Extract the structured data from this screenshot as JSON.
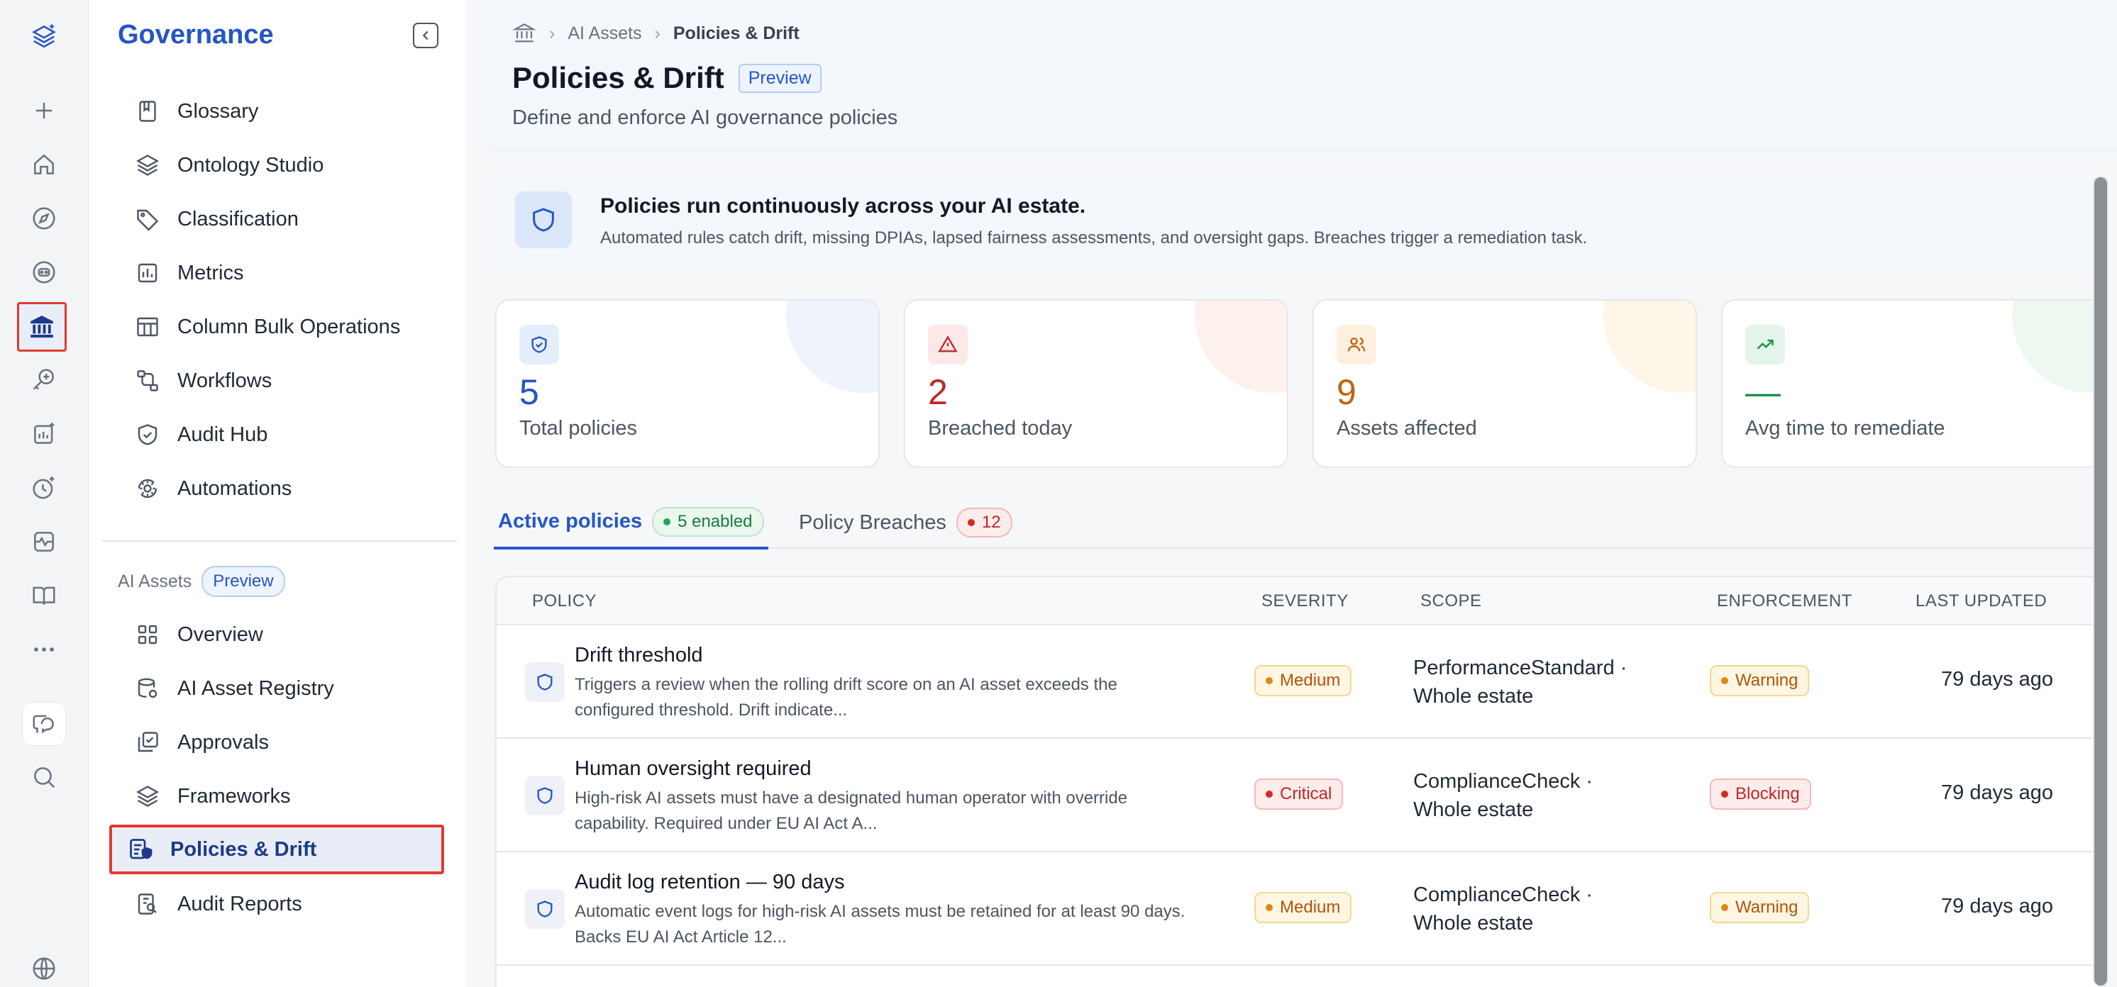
{
  "rail": {
    "items": [
      "layers-sparkle-icon",
      "plus-icon",
      "home-icon",
      "compass-icon",
      "bot-icon",
      "bank-icon",
      "key-search-icon",
      "analytics-sparkle-icon",
      "clock-sparkle-icon",
      "dashboard-icon",
      "book-icon",
      "more-icon",
      "chat-icon",
      "search-icon",
      "globe-icon"
    ]
  },
  "nav": {
    "title": "Governance",
    "items": [
      {
        "label": "Glossary",
        "icon": "bookmark-icon"
      },
      {
        "label": "Ontology Studio",
        "icon": "layers-icon"
      },
      {
        "label": "Classification",
        "icon": "tag-icon"
      },
      {
        "label": "Metrics",
        "icon": "chart-icon"
      },
      {
        "label": "Column Bulk Operations",
        "icon": "columns-icon"
      },
      {
        "label": "Workflows",
        "icon": "workflow-icon"
      },
      {
        "label": "Audit Hub",
        "icon": "shield-check-icon"
      },
      {
        "label": "Automations",
        "icon": "gear-cycle-icon"
      }
    ],
    "section_label": "AI Assets",
    "section_badge": "Preview",
    "ai_items": [
      {
        "label": "Overview",
        "icon": "grid-icon"
      },
      {
        "label": "AI Asset Registry",
        "icon": "database-icon"
      },
      {
        "label": "Approvals",
        "icon": "approval-icon"
      },
      {
        "label": "Frameworks",
        "icon": "layers-icon"
      },
      {
        "label": "Policies & Drift",
        "icon": "policy-icon"
      },
      {
        "label": "Audit Reports",
        "icon": "report-icon"
      }
    ]
  },
  "breadcrumb": {
    "level1": "AI Assets",
    "current": "Policies & Drift"
  },
  "page": {
    "title": "Policies & Drift",
    "badge": "Preview",
    "subtitle": "Define and enforce AI governance policies"
  },
  "banner": {
    "title": "Policies run continuously across your AI estate.",
    "text": "Automated rules catch drift, missing DPIAs, lapsed fairness assessments, and oversight gaps. Breaches trigger a remediation task."
  },
  "stats": [
    {
      "value": "5",
      "label": "Total policies",
      "color": "#2456c7",
      "bg": "#e6eefb",
      "blob": "#eef3fc"
    },
    {
      "value": "2",
      "label": "Breached today",
      "color": "#c02626",
      "bg": "#fde8e8",
      "blob": "#fdf1ee"
    },
    {
      "value": "9",
      "label": "Assets affected",
      "color": "#c2620c",
      "bg": "#fdf0df",
      "blob": "#fdf6e9"
    },
    {
      "value": "—",
      "label": "Avg time to remediate",
      "color": "#16924a",
      "bg": "#e3f5ea",
      "blob": "#eef8f1"
    }
  ],
  "tabs": [
    {
      "label": "Active policies",
      "count": "5 enabled"
    },
    {
      "label": "Policy Breaches",
      "count": "12"
    }
  ],
  "table": {
    "headers": [
      "POLICY",
      "SEVERITY",
      "SCOPE",
      "ENFORCEMENT",
      "LAST UPDATED"
    ],
    "rows": [
      {
        "name": "Drift threshold",
        "desc": "Triggers a review when the rolling drift score on an AI asset exceeds the configured threshold. Drift indicate...",
        "severity": "Medium",
        "scope1": "PerformanceStandard ·",
        "scope2": "Whole estate",
        "enforcement": "Warning",
        "updated": "79 days ago"
      },
      {
        "name": "Human oversight required",
        "desc": "High-risk AI assets must have a designated human operator with override capability. Required under EU AI Act A...",
        "severity": "Critical",
        "scope1": "ComplianceCheck ·",
        "scope2": "Whole estate",
        "enforcement": "Blocking",
        "updated": "79 days ago"
      },
      {
        "name": "Audit log retention — 90 days",
        "desc": "Automatic event logs for high-risk AI assets must be retained for at least 90 days. Backs EU AI Act Article 12...",
        "severity": "Medium",
        "scope1": "ComplianceCheck ·",
        "scope2": "Whole estate",
        "enforcement": "Warning",
        "updated": "79 days ago"
      }
    ]
  }
}
